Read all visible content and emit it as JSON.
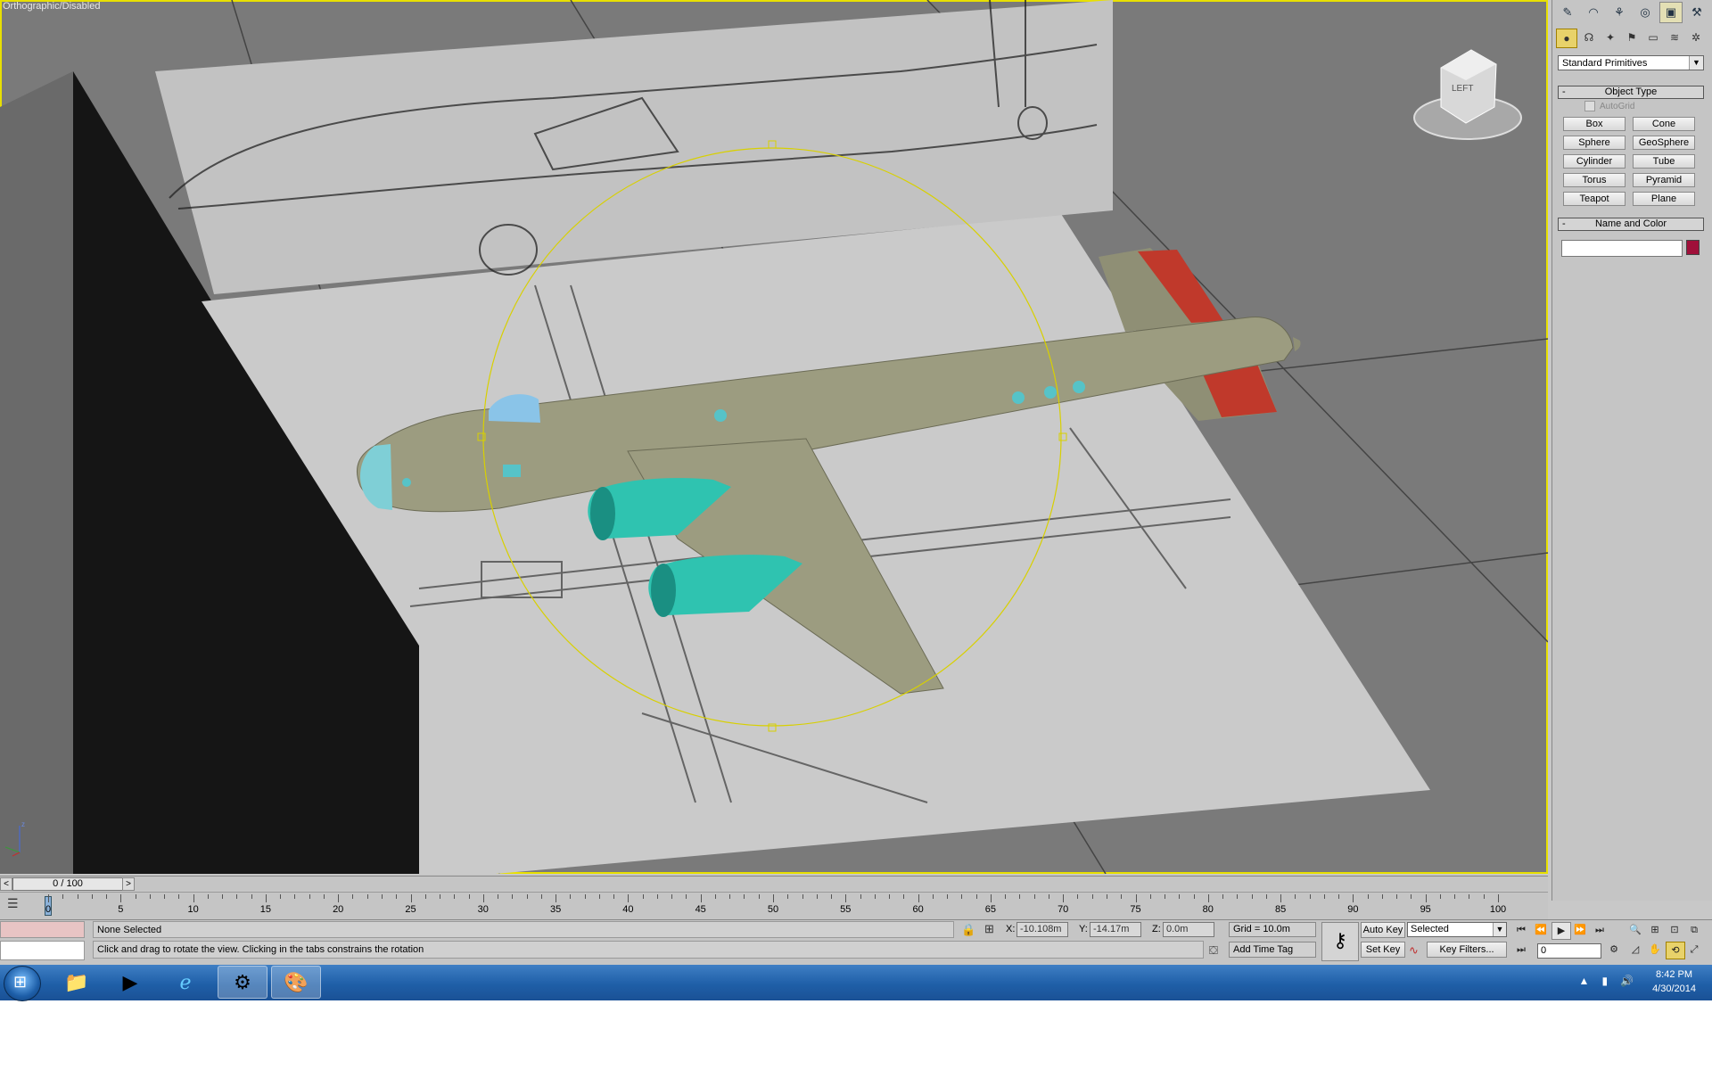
{
  "viewport": {
    "label": "Orthographic/Disabled",
    "viewcube_label": "LEFT"
  },
  "command_panel": {
    "tabs": [
      "create-tab",
      "modify-tab",
      "hierarchy-tab",
      "motion-tab",
      "display-tab",
      "utilities-tab"
    ],
    "category_dropdown": "Standard Primitives",
    "object_type": {
      "title": "Object Type",
      "autogrid_label": "AutoGrid",
      "buttons": [
        "Box",
        "Cone",
        "Sphere",
        "GeoSphere",
        "Cylinder",
        "Tube",
        "Torus",
        "Pyramid",
        "Teapot",
        "Plane"
      ]
    },
    "name_and_color": {
      "title": "Name and Color",
      "name_value": "",
      "color": "#a0103a"
    },
    "rollout_minus": "-"
  },
  "timeline": {
    "slider_label": "0 / 100",
    "prev": "<",
    "next": ">",
    "ticks": [
      "0",
      "5",
      "10",
      "15",
      "20",
      "25",
      "30",
      "35",
      "40",
      "45",
      "50",
      "55",
      "60",
      "65",
      "70",
      "75",
      "80",
      "85",
      "90",
      "95",
      "100"
    ]
  },
  "status": {
    "selection": "None Selected",
    "prompt": "Click and drag to rotate the view.  Clicking in the tabs constrains the rotation",
    "x_label": "X:",
    "x_value": "-10.108m",
    "y_label": "Y:",
    "y_value": "-14.17m",
    "z_label": "Z:",
    "z_value": "0.0m",
    "grid": "Grid = 10.0m",
    "add_time_tag": "Add Time Tag",
    "auto_key": "Auto Key",
    "set_key": "Set Key",
    "key_mode": "Selected",
    "key_filters": "Key Filters...",
    "current_frame": "0"
  },
  "taskbar": {
    "time": "8:42 PM",
    "date": "4/30/2014"
  }
}
